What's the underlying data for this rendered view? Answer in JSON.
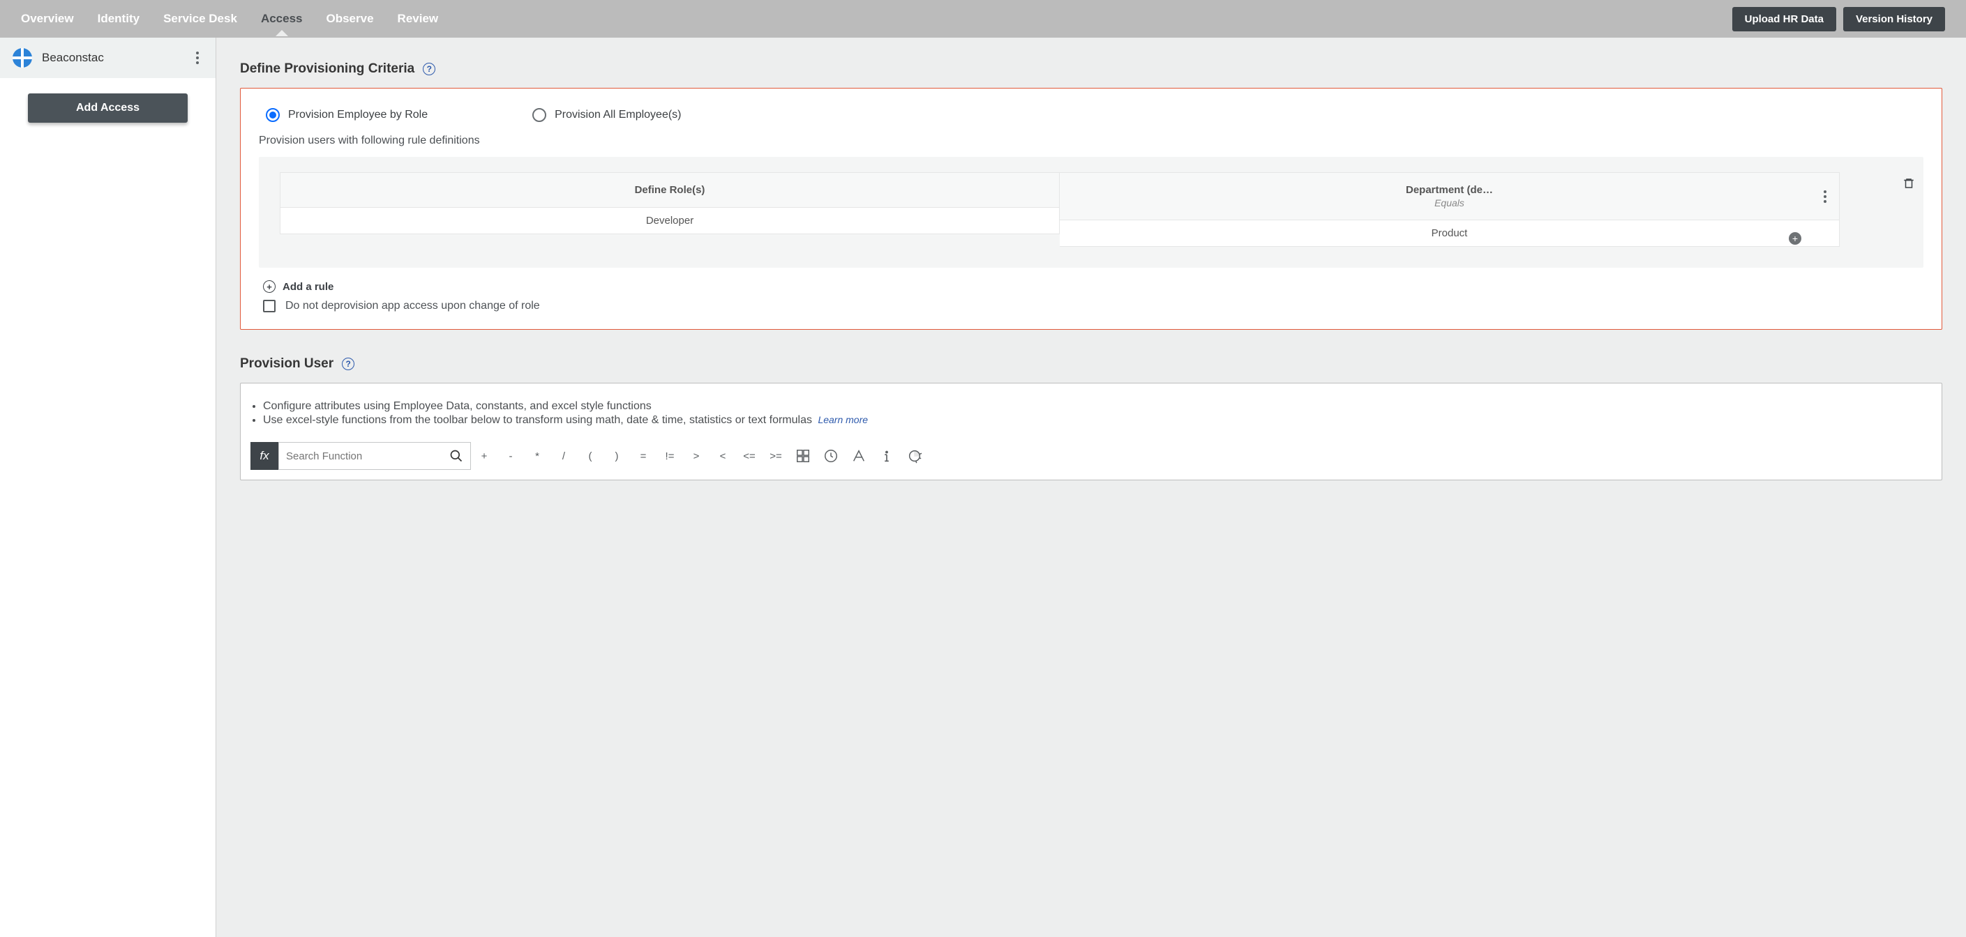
{
  "nav": {
    "tabs": [
      "Overview",
      "Identity",
      "Service Desk",
      "Access",
      "Observe",
      "Review"
    ],
    "active": "Access",
    "actions": {
      "upload": "Upload HR Data",
      "history": "Version History"
    }
  },
  "sidebar": {
    "app_name": "Beaconstac",
    "add_access": "Add Access"
  },
  "criteria": {
    "title": "Define Provisioning Criteria",
    "option_by_role": "Provision Employee by Role",
    "option_all": "Provision All Employee(s)",
    "selected": "by_role",
    "subhead": "Provision users with following rule definitions",
    "table": {
      "col1_header": "Define Role(s)",
      "col2_header": "Department (de…",
      "col2_op": "Equals",
      "row": {
        "role": "Developer",
        "dept": "Product"
      }
    },
    "add_rule": "Add a rule",
    "checkbox": "Do not deprovision app access upon change of role"
  },
  "provision_user": {
    "title": "Provision User",
    "bullets": [
      "Configure attributes using Employee Data, constants, and excel style functions",
      "Use excel-style functions from the toolbar below to transform using math, date & time, statistics or text formulas"
    ],
    "learn_more": "Learn more",
    "toolbar": {
      "fx": "fx",
      "search_placeholder": "Search Function",
      "operators": [
        "+",
        "-",
        "*",
        "/",
        "(",
        ")",
        "=",
        "!=",
        ">",
        "<",
        "<=",
        ">="
      ]
    }
  }
}
